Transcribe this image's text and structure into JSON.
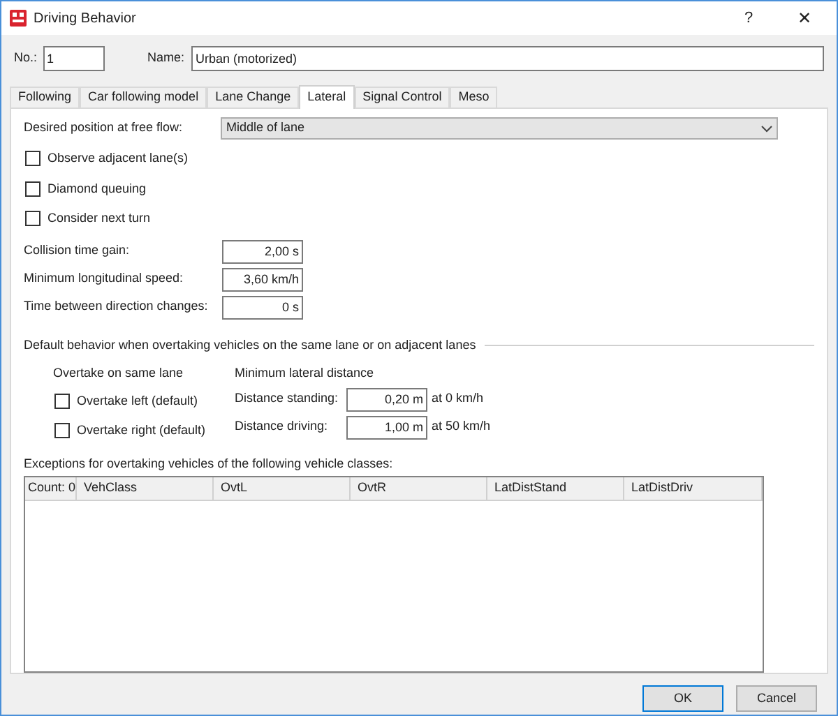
{
  "window": {
    "title": "Driving Behavior",
    "help": "?",
    "close": "✕"
  },
  "header": {
    "number_label": "No.:",
    "number": "1",
    "name_label": "Name:",
    "name": "Urban (motorized)"
  },
  "tabs": [
    {
      "label": "Following",
      "selected": false
    },
    {
      "label": "Car following model",
      "selected": false
    },
    {
      "label": "Lane Change",
      "selected": false
    },
    {
      "label": "Lateral",
      "selected": true
    },
    {
      "label": "Signal Control",
      "selected": false
    },
    {
      "label": "Meso",
      "selected": false
    }
  ],
  "desired_position": {
    "label": "Desired position at free flow:",
    "value": "Middle of lane"
  },
  "options": [
    {
      "label": "Observe adjacent lane(s)",
      "checked": false
    },
    {
      "label": "Diamond queuing",
      "checked": false
    },
    {
      "label": "Consider next turn",
      "checked": false
    }
  ],
  "fields": [
    {
      "label": "Collision time gain:",
      "value": "2,00 s"
    },
    {
      "label": "Minimum longitudinal speed:",
      "value": "3,60 km/h"
    },
    {
      "label": "Time between direction changes:",
      "value": "0 s"
    }
  ],
  "overtaking": {
    "title": "Default behavior when overtaking vehicles on the same lane or on adjacent lanes",
    "same_lane_label": "Overtake on same lane",
    "same_lane_options": [
      {
        "label": "Overtake left (default)",
        "checked": false
      },
      {
        "label": "Overtake right (default)",
        "checked": false
      }
    ],
    "distance_label": "Minimum lateral distance",
    "distances": [
      {
        "label": "Distance standing:",
        "value": "0,20 m",
        "suffix": "at 0 km/h"
      },
      {
        "label": "Distance driving:",
        "value": "1,00 m",
        "suffix": "at 50 km/h"
      }
    ]
  },
  "exceptions": {
    "label": "Exceptions for overtaking vehicles of the following vehicle classes:",
    "count": "Count: 0",
    "columns": [
      "VehClass",
      "OvtL",
      "OvtR",
      "LatDistStand",
      "LatDistDriv"
    ]
  },
  "buttons": [
    "OK",
    "Cancel"
  ]
}
